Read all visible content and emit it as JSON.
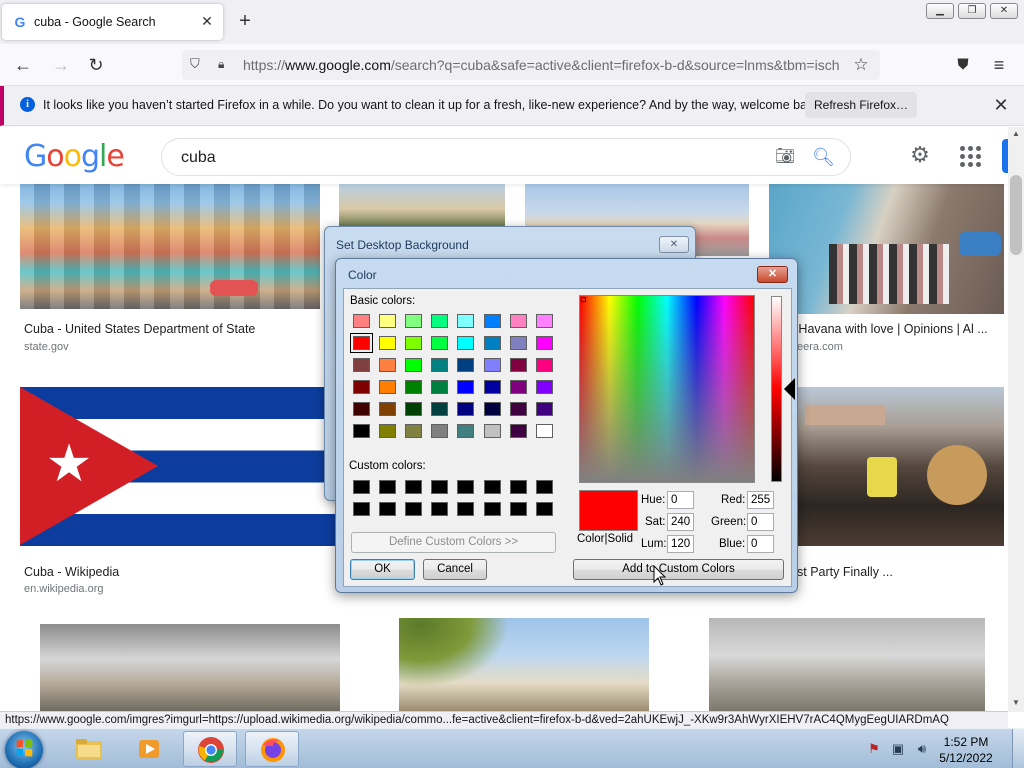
{
  "browser": {
    "tab_title": "cuba - Google Search",
    "tab_favicon": "G",
    "url_domain": "www.google.com",
    "url_prefix": "https://",
    "url_rest": "/search?q=cuba&safe=active&client=firefox-b-d&source=lnms&tbm=isch",
    "notification_text": "It looks like you haven’t started Firefox in a while. Do you want to clean it up for a fresh, like-new experience? And by the way, welcome back!",
    "notification_button": "Refresh Firefox…",
    "status_url": "https://www.google.com/imgres?imgurl=https://upload.wikimedia.org/wikipedia/commo...fe=active&client=firefox-b-d&ved=2ahUKEwjJ_-XKw9r3AhWyrXIEHV7rAC4QMygEegUIARDmAQ"
  },
  "google": {
    "logo_letters": [
      "G",
      "o",
      "o",
      "g",
      "l",
      "e"
    ],
    "logo_colors": [
      "#4285f4",
      "#ea4335",
      "#fbbc05",
      "#4285f4",
      "#34a853",
      "#ea4335"
    ],
    "search_query": "cuba",
    "results": [
      {
        "title": "Cuba - United States Department of State",
        "site": "state.gov"
      },
      {
        "title": "h Havana with love | Opinions | Al ...",
        "site": "eera.com"
      },
      {
        "title": "Cuba - Wikipedia",
        "site": "en.wikipedia.org"
      },
      {
        "title": "st Party Finally ...",
        "site": ""
      }
    ]
  },
  "background_dialog": {
    "title": "Set Desktop Background",
    "close_glyph": "✕"
  },
  "color_dialog": {
    "title": "Color",
    "close_glyph": "✕",
    "basic_colors_label": "Basic colors:",
    "custom_colors_label": "Custom colors:",
    "basic_colors": [
      "#ff8080",
      "#ffff80",
      "#80ff80",
      "#00ff80",
      "#80ffff",
      "#0080ff",
      "#ff80c0",
      "#ff80ff",
      "#ff0000",
      "#ffff00",
      "#80ff00",
      "#00ff40",
      "#00ffff",
      "#0080c0",
      "#8080c0",
      "#ff00ff",
      "#804040",
      "#ff8040",
      "#00ff00",
      "#008080",
      "#004080",
      "#8080ff",
      "#800040",
      "#ff0080",
      "#800000",
      "#ff8000",
      "#008000",
      "#008040",
      "#0000ff",
      "#0000a0",
      "#800080",
      "#8000ff",
      "#400000",
      "#804000",
      "#004000",
      "#004040",
      "#000080",
      "#000040",
      "#400040",
      "#400080",
      "#000000",
      "#808000",
      "#808040",
      "#808080",
      "#408080",
      "#c0c0c0",
      "#400040",
      "#ffffff"
    ],
    "selected_index": 8,
    "custom_colors": [
      "#000000",
      "#000000",
      "#000000",
      "#000000",
      "#000000",
      "#000000",
      "#000000",
      "#000000",
      "#000000",
      "#000000",
      "#000000",
      "#000000",
      "#000000",
      "#000000",
      "#000000",
      "#000000"
    ],
    "define_button": "Define Custom Colors >>",
    "ok_button": "OK",
    "cancel_button": "Cancel",
    "color_solid_label": "Color|Solid",
    "hue_label": "Hue:",
    "hue_value": "0",
    "sat_label": "Sat:",
    "sat_value": "240",
    "lum_label": "Lum:",
    "lum_value": "120",
    "red_label": "Red:",
    "red_value": "255",
    "green_label": "Green:",
    "green_value": "0",
    "blue_label": "Blue:",
    "blue_value": "0",
    "add_button": "Add to Custom Colors",
    "current_color": "#ff0000"
  },
  "taskbar": {
    "time": "1:52 PM",
    "date": "5/12/2022"
  }
}
